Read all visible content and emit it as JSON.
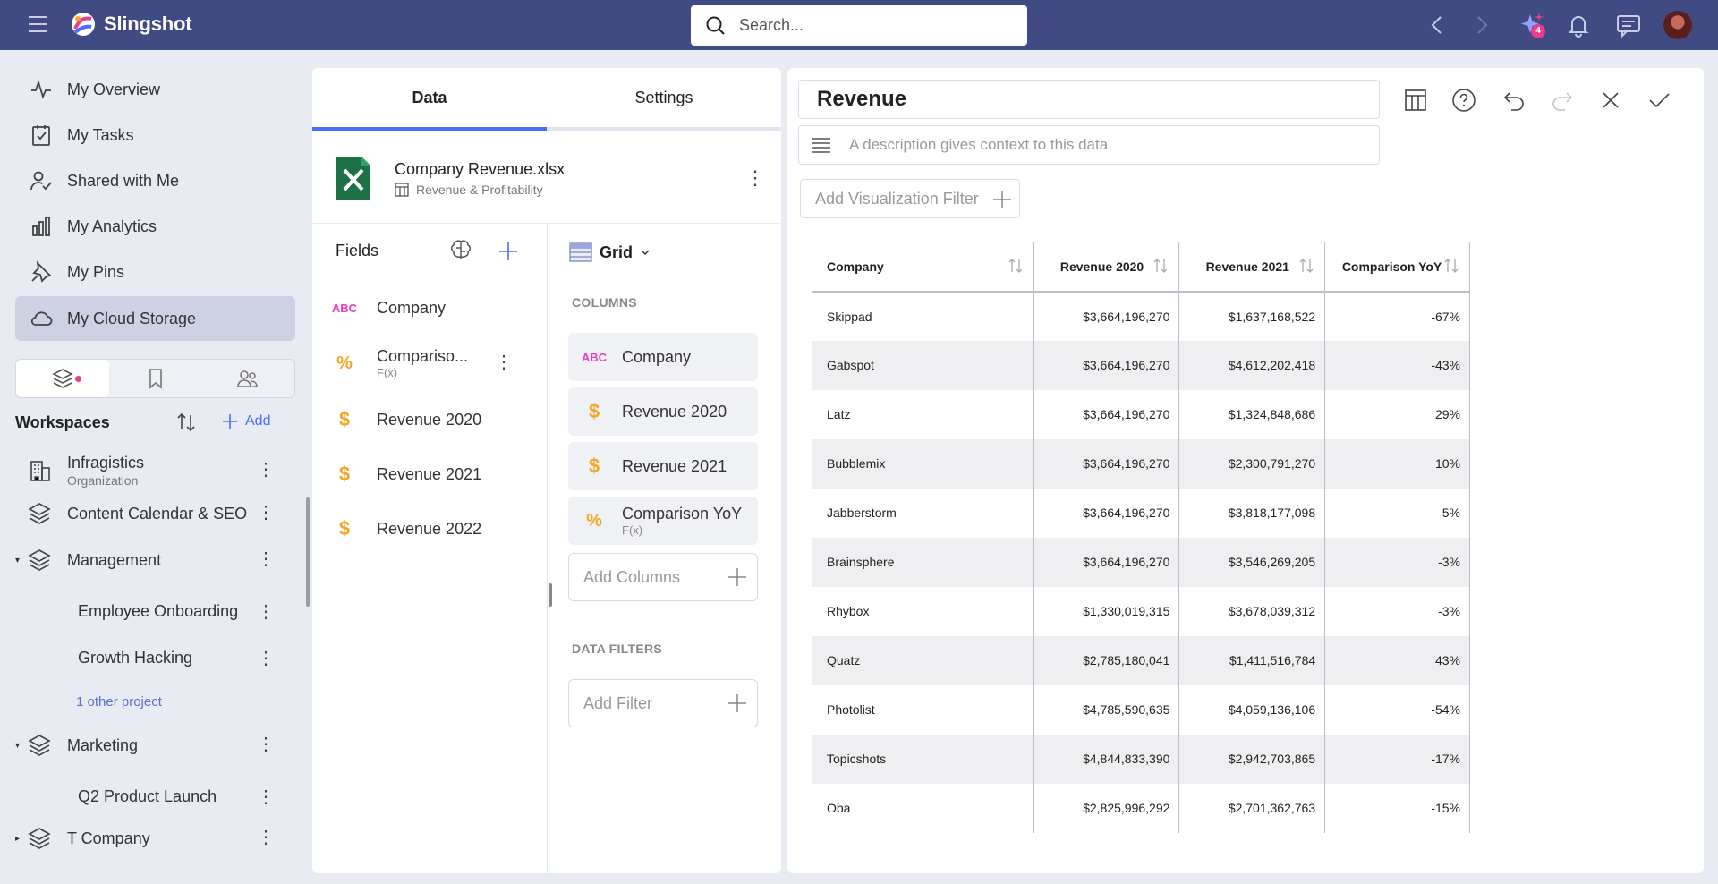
{
  "app": {
    "name": "Slingshot"
  },
  "search": {
    "placeholder": "Search..."
  },
  "notifications": {
    "badge_count": "4"
  },
  "nav": {
    "items": [
      {
        "label": "My Overview",
        "icon": "activity-icon"
      },
      {
        "label": "My Tasks",
        "icon": "task-icon"
      },
      {
        "label": "Shared with Me",
        "icon": "shared-user-icon"
      },
      {
        "label": "My Analytics",
        "icon": "bar-chart-icon"
      },
      {
        "label": "My Pins",
        "icon": "pin-icon"
      },
      {
        "label": "My Cloud Storage",
        "icon": "cloud-icon",
        "active": true
      }
    ]
  },
  "workspaces": {
    "title": "Workspaces",
    "add_label": "Add",
    "items": [
      {
        "label": "Infragistics",
        "sub": "Organization"
      },
      {
        "label": "Content Calendar & SEO"
      },
      {
        "label": "Management",
        "children": [
          "Employee Onboarding",
          "Growth Hacking"
        ],
        "more": "1 other project"
      },
      {
        "label": "Marketing",
        "children": [
          "Q2 Product Launch"
        ]
      },
      {
        "label": "T Company"
      }
    ]
  },
  "data_panel": {
    "tabs": [
      "Data",
      "Settings"
    ],
    "active_tab": "Data",
    "source": {
      "file": "Company Revenue.xlsx",
      "sheet": "Revenue & Profitability"
    },
    "fields_title": "Fields",
    "fields": [
      {
        "type": "ABC",
        "label": "Company"
      },
      {
        "type": "%",
        "label": "Compariso...",
        "sub": "F(x)"
      },
      {
        "type": "$",
        "label": "Revenue 2020"
      },
      {
        "type": "$",
        "label": "Revenue 2021"
      },
      {
        "type": "$",
        "label": "Revenue 2022"
      }
    ],
    "viz_type": "Grid",
    "columns_title": "COLUMNS",
    "columns": [
      {
        "type": "ABC",
        "label": "Company"
      },
      {
        "type": "$",
        "label": "Revenue 2020"
      },
      {
        "type": "$",
        "label": "Revenue 2021"
      },
      {
        "type": "%",
        "label": "Comparison YoY",
        "sub": "F(x)"
      }
    ],
    "add_columns": "Add Columns",
    "filters_title": "DATA FILTERS",
    "add_filter": "Add Filter"
  },
  "viz": {
    "title": "Revenue",
    "description_placeholder": "A description gives context to this data",
    "add_filter": "Add Visualization Filter",
    "table": {
      "headers": [
        "Company",
        "Revenue 2020",
        "Revenue 2021",
        "Comparison YoY"
      ],
      "rows": [
        [
          "Skippad",
          "$3,664,196,270",
          "$1,637,168,522",
          "-67%"
        ],
        [
          "Gabspot",
          "$3,664,196,270",
          "$4,612,202,418",
          "-43%"
        ],
        [
          "Latz",
          "$3,664,196,270",
          "$1,324,848,686",
          "29%"
        ],
        [
          "Bubblemix",
          "$3,664,196,270",
          "$2,300,791,270",
          "10%"
        ],
        [
          "Jabberstorm",
          "$3,664,196,270",
          "$3,818,177,098",
          "5%"
        ],
        [
          "Brainsphere",
          "$3,664,196,270",
          "$3,546,269,205",
          "-3%"
        ],
        [
          "Rhybox",
          "$1,330,019,315",
          "$3,678,039,312",
          "-3%"
        ],
        [
          "Quatz",
          "$2,785,180,041",
          "$1,411,516,784",
          "43%"
        ],
        [
          "Photolist",
          "$4,785,590,635",
          "$4,059,136,106",
          "-54%"
        ],
        [
          "Topicshots",
          "$4,844,833,390",
          "$2,942,703,865",
          "-17%"
        ],
        [
          "Oba",
          "$2,825,996,292",
          "$2,701,362,763",
          "-15%"
        ]
      ]
    }
  },
  "colors": {
    "topbar": "#414b83",
    "accent": "#4b6cff",
    "abc": "#e83ec0",
    "numeric": "#f5a623",
    "excel": "#1e7145"
  }
}
